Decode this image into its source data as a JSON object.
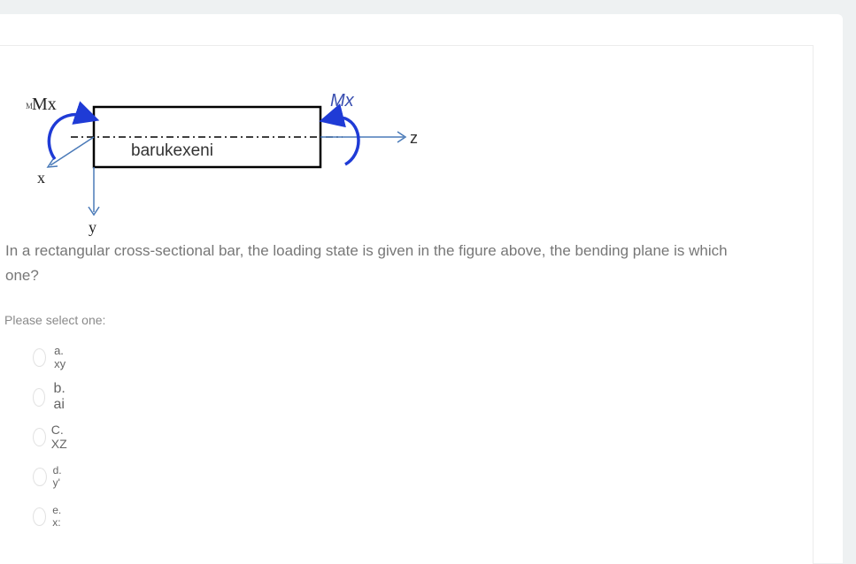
{
  "figure": {
    "moment_left_label": "Mx",
    "moment_left_prefix": "M",
    "moment_right_label": "Mx",
    "bar_label": "barukexeni",
    "axis_x": "x",
    "axis_y": "y",
    "axis_z": "z",
    "arrow_color": "#1f3bd6",
    "axis_color": "#4a7ab8"
  },
  "question": {
    "text": "In a rectangular cross-sectional bar, the loading state is given in the figure above, the bending plane is which one?",
    "prompt": "Please select one:"
  },
  "options": [
    {
      "label": "a. xy"
    },
    {
      "label": "b. ai"
    },
    {
      "label": "c. xz"
    },
    {
      "label": "d. y'"
    },
    {
      "label": "e. x:"
    }
  ]
}
